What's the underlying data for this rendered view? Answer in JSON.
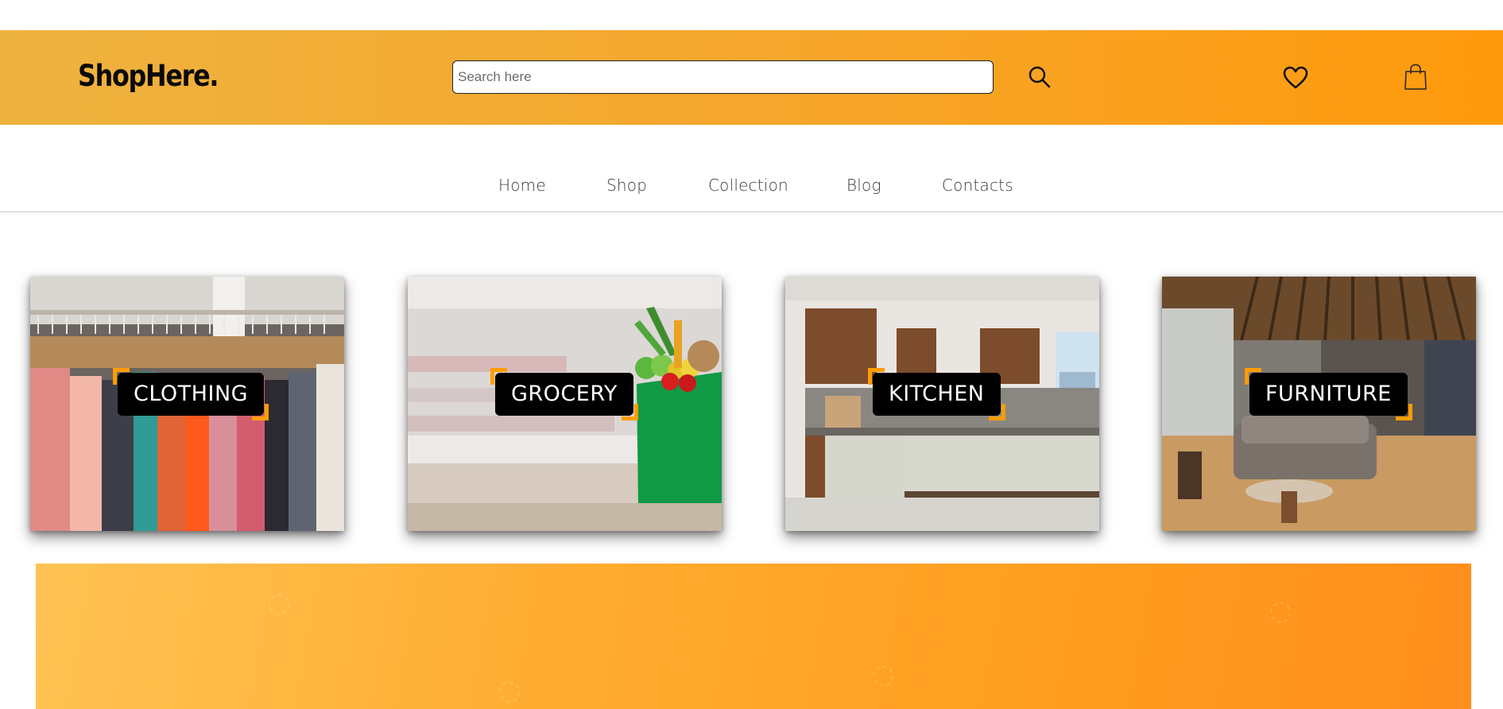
{
  "header": {
    "logo": "ShopHere.",
    "search": {
      "placeholder": "Search here",
      "value": ""
    },
    "icons": [
      "search-icon",
      "heart-icon",
      "shopping-bag-icon"
    ]
  },
  "nav": {
    "items": [
      {
        "label": "Home"
      },
      {
        "label": "Shop"
      },
      {
        "label": "Collection"
      },
      {
        "label": "Blog"
      },
      {
        "label": "Contacts"
      }
    ]
  },
  "categories": [
    {
      "label": "CLOTHING"
    },
    {
      "label": "GROCERY"
    },
    {
      "label": "KITCHEN"
    },
    {
      "label": "FURNITURE"
    }
  ],
  "colors": {
    "header_gradient_start": "#eeb33f",
    "header_gradient_end": "#ff9a0c",
    "accent": "#ff9d00",
    "label_bg": "#000000"
  }
}
